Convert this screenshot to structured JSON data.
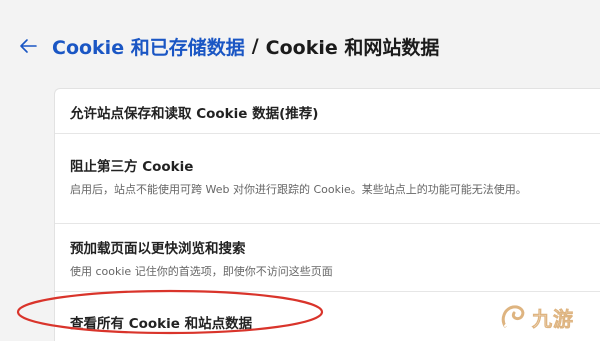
{
  "header": {
    "breadcrumb_parent": "Cookie 和已存储数据",
    "separator": "/",
    "breadcrumb_current": "Cookie 和网站数据"
  },
  "settings": [
    {
      "title": "允许站点保存和读取 Cookie 数据(推荐)"
    },
    {
      "title": "阻止第三方 Cookie",
      "description": "启用后，站点不能使用可跨 Web 对你进行跟踪的 Cookie。某些站点上的功能可能无法使用。"
    },
    {
      "title": "预加载页面以更快浏览和搜索",
      "description": "使用 cookie 记住你的首选项，即使你不访问这些页面"
    },
    {
      "title": "查看所有 Cookie 和站点数据"
    }
  ],
  "watermark": {
    "text": "九游"
  },
  "colors": {
    "link": "#1a56c4",
    "annotation_circle": "#d9342b",
    "background": "#f3f3f3"
  }
}
